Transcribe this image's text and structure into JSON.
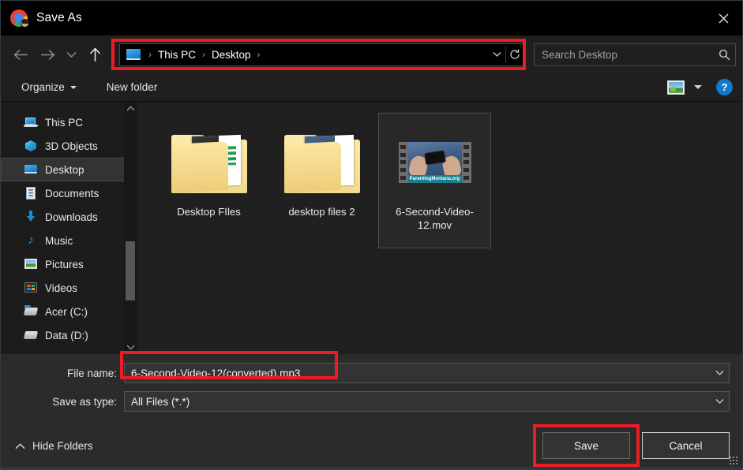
{
  "window": {
    "title": "Save As",
    "app_icon": "chrome-logo-icon",
    "close_label": "✕"
  },
  "nav": {
    "back": "←",
    "forward": "→",
    "recent_chevron": "∨",
    "up": "↑",
    "address": {
      "icon": "desktop-icon",
      "crumbs": [
        "This PC",
        "Desktop"
      ],
      "separator": "›",
      "history_chevron": "∨",
      "refresh": "↻"
    },
    "search": {
      "placeholder": "Search Desktop",
      "value": "",
      "icon": "search-icon"
    }
  },
  "commandbar": {
    "organize": "Organize",
    "new_folder": "New folder",
    "view_icon": "picture-view-icon",
    "view_chevron": "▼",
    "help": "?"
  },
  "sidebar": {
    "items": [
      {
        "label": "This PC",
        "icon": "this-pc-icon",
        "selected": false
      },
      {
        "label": "3D Objects",
        "icon": "3d-objects-icon",
        "selected": false
      },
      {
        "label": "Desktop",
        "icon": "desktop-icon",
        "selected": true
      },
      {
        "label": "Documents",
        "icon": "documents-icon",
        "selected": false
      },
      {
        "label": "Downloads",
        "icon": "downloads-icon",
        "selected": false
      },
      {
        "label": "Music",
        "icon": "music-icon",
        "selected": false
      },
      {
        "label": "Pictures",
        "icon": "pictures-icon",
        "selected": false
      },
      {
        "label": "Videos",
        "icon": "videos-icon",
        "selected": false
      },
      {
        "label": "Acer (C:)",
        "icon": "drive-icon",
        "selected": false
      },
      {
        "label": "Data (D:)",
        "icon": "drive-icon",
        "selected": false
      }
    ],
    "scroll_up": "⌃",
    "scroll_down": "⌄"
  },
  "files": [
    {
      "name": "Desktop FIles",
      "type": "folder",
      "selected": false
    },
    {
      "name": "desktop files 2",
      "type": "folder",
      "selected": false
    },
    {
      "name": "6-Second-Video-12.mov",
      "type": "video",
      "selected": true,
      "thumb_caption": "ParentingMontana.org"
    }
  ],
  "form": {
    "filename_label": "File name:",
    "filename_value": "6-Second-Video-12(converted).mp3",
    "savetype_label": "Save as type:",
    "savetype_value": "All Files (*.*)",
    "dropdown_chevron": "⌄"
  },
  "footer": {
    "hide_folders": "Hide Folders",
    "hide_folders_chevron": "⌃",
    "save": "Save",
    "cancel": "Cancel"
  },
  "highlights": {
    "color": "#ed1c24",
    "targets": [
      "address-bar",
      "filename-input",
      "save-button"
    ]
  }
}
